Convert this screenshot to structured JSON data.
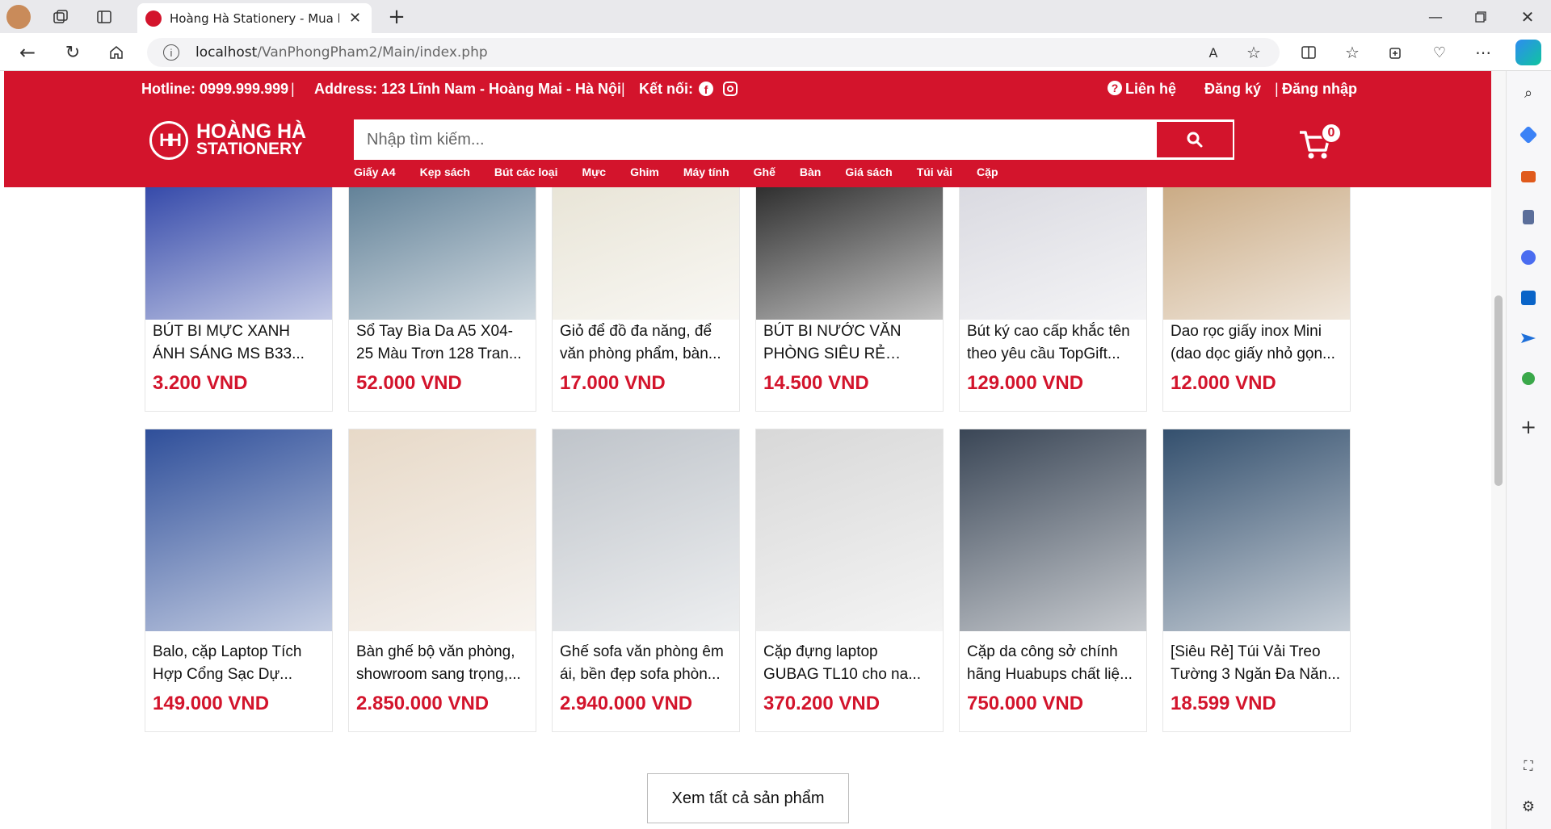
{
  "browser": {
    "tab_title": "Hoàng Hà Stationery - Mua bán",
    "url_host": "localhost",
    "url_path": "/VanPhongPham2/Main/index.php"
  },
  "header": {
    "hotline": "Hotline: 0999.999.999",
    "address": "Address: 123 Lĩnh Nam - Hoàng Mai - Hà Nội",
    "connect": "Kết nối:",
    "contact": "Liên hệ",
    "register": "Đăng ký",
    "login": "Đăng nhập",
    "logo_line1": "HOÀNG HÀ",
    "logo_line2": "STATIONERY",
    "logo_mark": "HH",
    "search_placeholder": "Nhập tìm kiếm...",
    "cart_count": "0",
    "separator": "|",
    "categories": [
      "Giấy A4",
      "Kẹp sách",
      "Bút các loại",
      "Mực",
      "Ghim",
      "Máy tính",
      "Ghế",
      "Bàn",
      "Giá sách",
      "Túi vải",
      "Cặp"
    ]
  },
  "products": [
    {
      "name": "BÚT BI MỰC XANH ÁNH SÁNG MS B33...",
      "price": "3.200 VND",
      "thumb": "#3146a8"
    },
    {
      "name": "Sổ Tay Bìa Da A5 X04-25 Màu Trơn 128 Tran...",
      "price": "52.000 VND",
      "thumb": "#5f7f96"
    },
    {
      "name": "Giỏ để đồ đa năng, để văn phòng phẩm, bàn...",
      "price": "17.000 VND",
      "thumb": "#e8e4d6"
    },
    {
      "name": "BÚT BI NƯỚC VĂN PHÒNG SIÊU RẺ SIÊU...",
      "price": "14.500 VND",
      "thumb": "#2a2a2a"
    },
    {
      "name": "Bút ký cao cấp khắc tên theo yêu cầu TopGift...",
      "price": "129.000 VND",
      "thumb": "#d9d9e0"
    },
    {
      "name": "Dao rọc giấy inox Mini (dao dọc giấy nhỏ gọn...",
      "price": "12.000 VND",
      "thumb": "#c9a982"
    },
    {
      "name": "Balo, cặp Laptop Tích Hợp Cổng Sạc Dự...",
      "price": "149.000 VND",
      "thumb": "#2f4f9a"
    },
    {
      "name": "Bàn ghế bộ văn phòng, showroom sang trọng,...",
      "price": "2.850.000 VND",
      "thumb": "#e7d9c8"
    },
    {
      "name": "Ghế sofa văn phòng êm ái, bền đẹp sofa phòn...",
      "price": "2.940.000 VND",
      "thumb": "#bfc4ca"
    },
    {
      "name": "Cặp đựng laptop GUBAG TL10 cho na...",
      "price": "370.200 VND",
      "thumb": "#d8d8d8"
    },
    {
      "name": "Cặp da công sở chính hãng Huabups chất liệ...",
      "price": "750.000 VND",
      "thumb": "#3a4656"
    },
    {
      "name": "[Siêu Rẻ] Túi Vải Treo Tường 3 Ngăn Đa Năn...",
      "price": "18.599 VND",
      "thumb": "#34506e"
    }
  ],
  "view_all": "Xem tất cả sản phẩm",
  "colors": {
    "brand": "#d3142c"
  }
}
